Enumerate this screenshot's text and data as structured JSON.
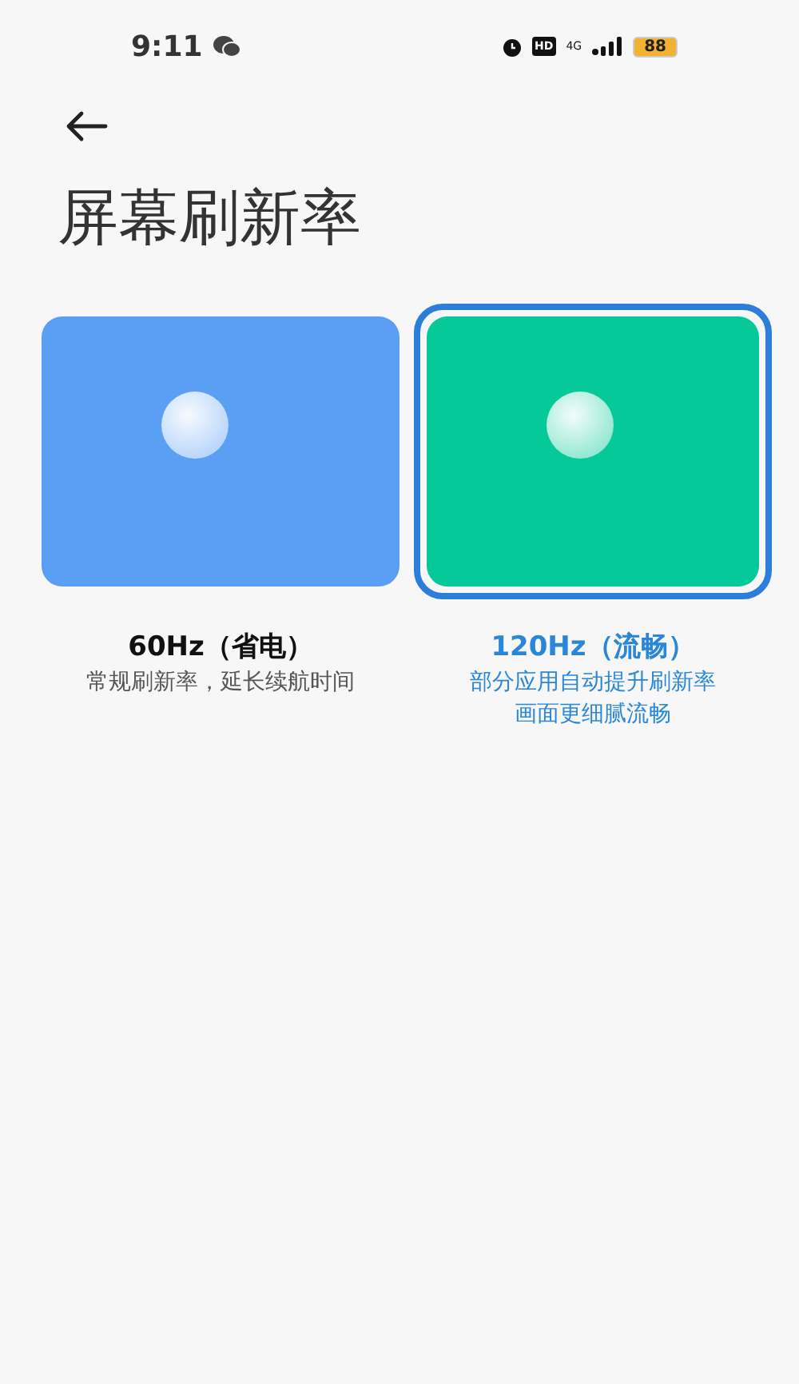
{
  "status_bar": {
    "time": "9:11",
    "hd": "HD",
    "network": "4G",
    "battery": "88"
  },
  "title": "屏幕刷新率",
  "options": [
    {
      "label": "60Hz（省电）",
      "description": [
        "常规刷新率，延长续航时间"
      ],
      "color": "#5b9ff5",
      "selected": false
    },
    {
      "label": "120Hz（流畅）",
      "description": [
        "部分应用自动提升刷新率",
        "画面更细腻流畅"
      ],
      "color": "#05c998",
      "selected": true
    }
  ]
}
